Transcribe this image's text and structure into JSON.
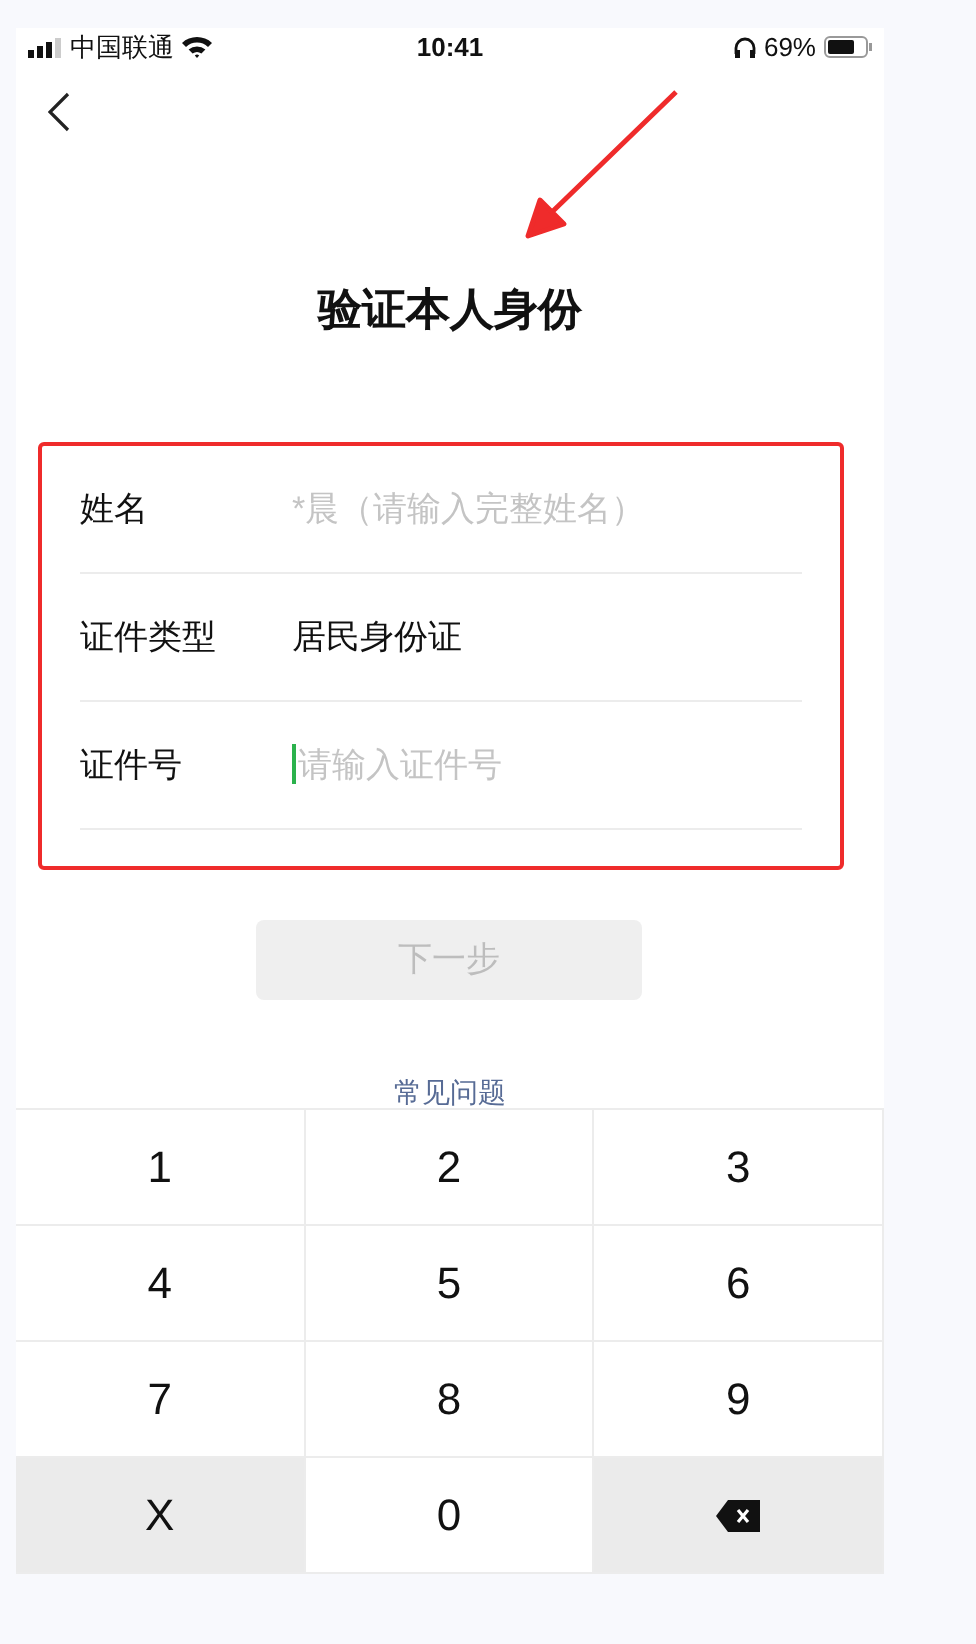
{
  "status_bar": {
    "carrier": "中国联通",
    "time": "10:41",
    "battery": "69%"
  },
  "title": "验证本人身份",
  "form": {
    "rows": [
      {
        "label": "姓名",
        "kind": "input",
        "placeholder": "*晨（请输入完整姓名）",
        "focused": false
      },
      {
        "label": "证件类型",
        "kind": "value",
        "value": "居民身份证"
      },
      {
        "label": "证件号",
        "kind": "input",
        "placeholder": "请输入证件号",
        "focused": true
      }
    ]
  },
  "next_button": {
    "label": "下一步",
    "disabled": true
  },
  "faq_link": "常见问题",
  "keypad": {
    "keys": [
      {
        "label": "1",
        "kind": "digit"
      },
      {
        "label": "2",
        "kind": "digit"
      },
      {
        "label": "3",
        "kind": "digit"
      },
      {
        "label": "4",
        "kind": "digit"
      },
      {
        "label": "5",
        "kind": "digit"
      },
      {
        "label": "6",
        "kind": "digit"
      },
      {
        "label": "7",
        "kind": "digit"
      },
      {
        "label": "8",
        "kind": "digit"
      },
      {
        "label": "9",
        "kind": "digit"
      },
      {
        "label": "X",
        "kind": "function"
      },
      {
        "label": "0",
        "kind": "digit"
      },
      {
        "kind": "delete"
      }
    ]
  }
}
